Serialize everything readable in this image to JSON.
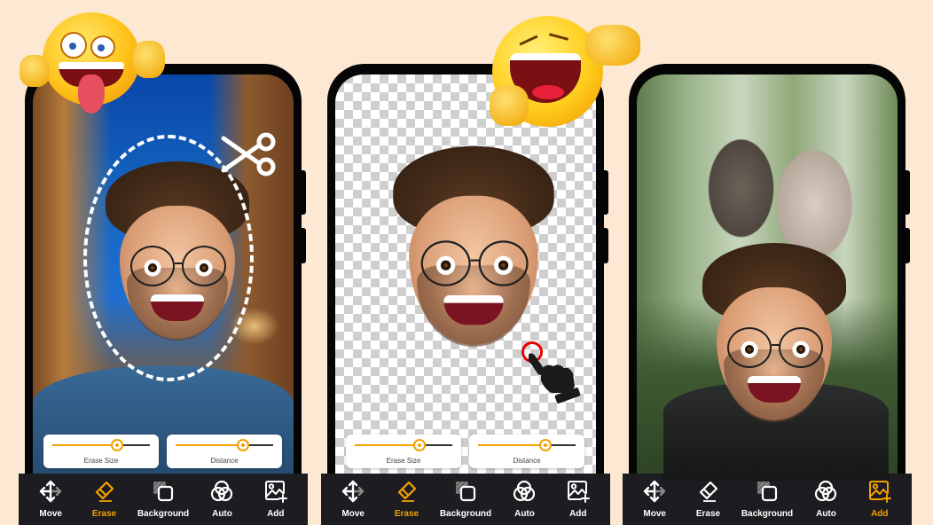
{
  "background_color": "#fde9d3",
  "accent_color": "#f4a100",
  "screens": [
    {
      "id": "screen-cutout",
      "scene": "city-night-selfie",
      "overlay_icon": "scissors-icon",
      "sliders": [
        {
          "label": "Erase Size",
          "value_percent": 66
        },
        {
          "label": "Distance",
          "value_percent": 69
        }
      ],
      "toolbar": {
        "active": "Erase",
        "items": [
          {
            "label": "Move",
            "icon": "move-arrows-icon"
          },
          {
            "label": "Erase",
            "icon": "eraser-icon"
          },
          {
            "label": "Background",
            "icon": "background-layers-icon"
          },
          {
            "label": "Auto",
            "icon": "auto-circles-icon"
          },
          {
            "label": "Add",
            "icon": "add-image-icon"
          }
        ]
      }
    },
    {
      "id": "screen-erase",
      "scene": "transparent-cutout-face",
      "overlay_icon": "hand-pointer-icon",
      "sliders": [
        {
          "label": "Erase Size",
          "value_percent": 66
        },
        {
          "label": "Distance",
          "value_percent": 69
        }
      ],
      "toolbar": {
        "active": "Erase",
        "items": [
          {
            "label": "Move",
            "icon": "move-arrows-icon"
          },
          {
            "label": "Erase",
            "icon": "eraser-icon"
          },
          {
            "label": "Background",
            "icon": "background-layers-icon"
          },
          {
            "label": "Auto",
            "icon": "auto-circles-icon"
          },
          {
            "label": "Add",
            "icon": "add-image-icon"
          }
        ]
      }
    },
    {
      "id": "screen-composite",
      "scene": "monkeys-forest-composite",
      "toolbar": {
        "active": "Add",
        "items": [
          {
            "label": "Move",
            "icon": "move-arrows-icon"
          },
          {
            "label": "Erase",
            "icon": "eraser-icon"
          },
          {
            "label": "Background",
            "icon": "background-layers-icon"
          },
          {
            "label": "Auto",
            "icon": "auto-circles-icon"
          },
          {
            "label": "Add",
            "icon": "add-image-icon"
          }
        ]
      }
    }
  ],
  "decorations": {
    "emoji_left": "tongue-out-emoji",
    "emoji_center": "laughing-pointing-emoji"
  }
}
